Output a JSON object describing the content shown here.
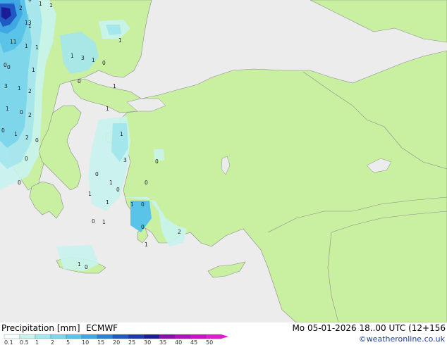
{
  "footer": {
    "title": "Precipitation [mm]",
    "model": "ECMWF",
    "valid_time": "Mo 05-01-2026 18..00 UTC (12+156",
    "credit": "©weatheronline.co.uk"
  },
  "legend": {
    "labels": [
      "0.1",
      "0.5",
      "1",
      "2",
      "5",
      "10",
      "15",
      "20",
      "25",
      "30",
      "35",
      "40",
      "45",
      "50"
    ],
    "colors": [
      "#f5fffd",
      "#c8f3ee",
      "#a3e6ec",
      "#7dd6e9",
      "#5ac3e8",
      "#3fa7e3",
      "#2b83d6",
      "#2059c3",
      "#1a3aae",
      "#1b1d97",
      "#8a0fb0",
      "#b20fc0",
      "#d010c8",
      "#e21ad0"
    ]
  },
  "colors": {
    "land": "#c8f0a0",
    "sea": "#ececec",
    "border": "#8c8c8c"
  },
  "map": {
    "point_values": [
      "1",
      "1",
      "0",
      "2",
      "11",
      "1",
      "1",
      "1",
      "13",
      "0",
      "0",
      "1",
      "1",
      "3",
      "1",
      "0",
      "0",
      "1",
      "3",
      "1",
      "2",
      "1",
      "0",
      "2",
      "0",
      "1",
      "2",
      "0",
      "1",
      "1",
      "3",
      "0",
      "0",
      "0",
      "1",
      "0",
      "1",
      "1",
      "0",
      "0",
      "1",
      "0",
      "1",
      "0",
      "0",
      "1",
      "2",
      "1",
      "0",
      "1"
    ]
  }
}
